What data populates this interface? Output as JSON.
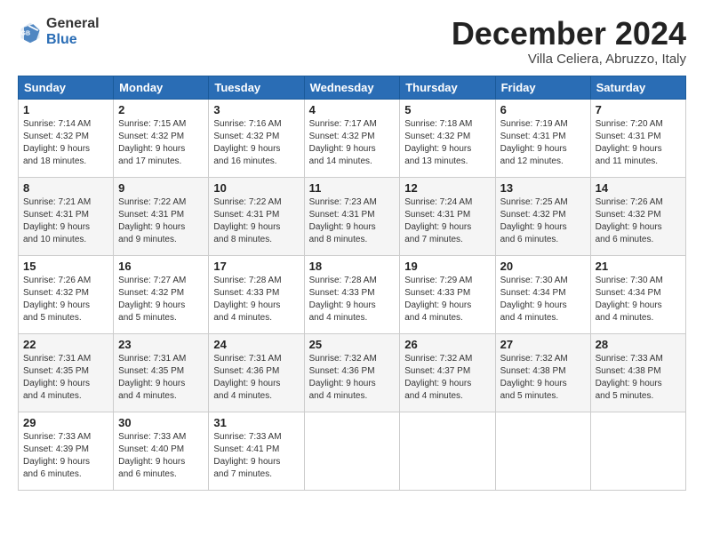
{
  "logo": {
    "general": "General",
    "blue": "Blue"
  },
  "title": "December 2024",
  "location": "Villa Celiera, Abruzzo, Italy",
  "days_of_week": [
    "Sunday",
    "Monday",
    "Tuesday",
    "Wednesday",
    "Thursday",
    "Friday",
    "Saturday"
  ],
  "weeks": [
    [
      {
        "day": "1",
        "sunrise": "7:14 AM",
        "sunset": "4:32 PM",
        "daylight_hours": "9",
        "daylight_minutes": "18"
      },
      {
        "day": "2",
        "sunrise": "7:15 AM",
        "sunset": "4:32 PM",
        "daylight_hours": "9",
        "daylight_minutes": "17"
      },
      {
        "day": "3",
        "sunrise": "7:16 AM",
        "sunset": "4:32 PM",
        "daylight_hours": "9",
        "daylight_minutes": "16"
      },
      {
        "day": "4",
        "sunrise": "7:17 AM",
        "sunset": "4:32 PM",
        "daylight_hours": "9",
        "daylight_minutes": "14"
      },
      {
        "day": "5",
        "sunrise": "7:18 AM",
        "sunset": "4:32 PM",
        "daylight_hours": "9",
        "daylight_minutes": "13"
      },
      {
        "day": "6",
        "sunrise": "7:19 AM",
        "sunset": "4:31 PM",
        "daylight_hours": "9",
        "daylight_minutes": "12"
      },
      {
        "day": "7",
        "sunrise": "7:20 AM",
        "sunset": "4:31 PM",
        "daylight_hours": "9",
        "daylight_minutes": "11"
      }
    ],
    [
      {
        "day": "8",
        "sunrise": "7:21 AM",
        "sunset": "4:31 PM",
        "daylight_hours": "9",
        "daylight_minutes": "10"
      },
      {
        "day": "9",
        "sunrise": "7:22 AM",
        "sunset": "4:31 PM",
        "daylight_hours": "9",
        "daylight_minutes": "9"
      },
      {
        "day": "10",
        "sunrise": "7:22 AM",
        "sunset": "4:31 PM",
        "daylight_hours": "9",
        "daylight_minutes": "8"
      },
      {
        "day": "11",
        "sunrise": "7:23 AM",
        "sunset": "4:31 PM",
        "daylight_hours": "9",
        "daylight_minutes": "8"
      },
      {
        "day": "12",
        "sunrise": "7:24 AM",
        "sunset": "4:31 PM",
        "daylight_hours": "9",
        "daylight_minutes": "7"
      },
      {
        "day": "13",
        "sunrise": "7:25 AM",
        "sunset": "4:32 PM",
        "daylight_hours": "9",
        "daylight_minutes": "6"
      },
      {
        "day": "14",
        "sunrise": "7:26 AM",
        "sunset": "4:32 PM",
        "daylight_hours": "9",
        "daylight_minutes": "6"
      }
    ],
    [
      {
        "day": "15",
        "sunrise": "7:26 AM",
        "sunset": "4:32 PM",
        "daylight_hours": "9",
        "daylight_minutes": "5"
      },
      {
        "day": "16",
        "sunrise": "7:27 AM",
        "sunset": "4:32 PM",
        "daylight_hours": "9",
        "daylight_minutes": "5"
      },
      {
        "day": "17",
        "sunrise": "7:28 AM",
        "sunset": "4:33 PM",
        "daylight_hours": "9",
        "daylight_minutes": "4"
      },
      {
        "day": "18",
        "sunrise": "7:28 AM",
        "sunset": "4:33 PM",
        "daylight_hours": "9",
        "daylight_minutes": "4"
      },
      {
        "day": "19",
        "sunrise": "7:29 AM",
        "sunset": "4:33 PM",
        "daylight_hours": "9",
        "daylight_minutes": "4"
      },
      {
        "day": "20",
        "sunrise": "7:30 AM",
        "sunset": "4:34 PM",
        "daylight_hours": "9",
        "daylight_minutes": "4"
      },
      {
        "day": "21",
        "sunrise": "7:30 AM",
        "sunset": "4:34 PM",
        "daylight_hours": "9",
        "daylight_minutes": "4"
      }
    ],
    [
      {
        "day": "22",
        "sunrise": "7:31 AM",
        "sunset": "4:35 PM",
        "daylight_hours": "9",
        "daylight_minutes": "4"
      },
      {
        "day": "23",
        "sunrise": "7:31 AM",
        "sunset": "4:35 PM",
        "daylight_hours": "9",
        "daylight_minutes": "4"
      },
      {
        "day": "24",
        "sunrise": "7:31 AM",
        "sunset": "4:36 PM",
        "daylight_hours": "9",
        "daylight_minutes": "4"
      },
      {
        "day": "25",
        "sunrise": "7:32 AM",
        "sunset": "4:36 PM",
        "daylight_hours": "9",
        "daylight_minutes": "4"
      },
      {
        "day": "26",
        "sunrise": "7:32 AM",
        "sunset": "4:37 PM",
        "daylight_hours": "9",
        "daylight_minutes": "4"
      },
      {
        "day": "27",
        "sunrise": "7:32 AM",
        "sunset": "4:38 PM",
        "daylight_hours": "9",
        "daylight_minutes": "5"
      },
      {
        "day": "28",
        "sunrise": "7:33 AM",
        "sunset": "4:38 PM",
        "daylight_hours": "9",
        "daylight_minutes": "5"
      }
    ],
    [
      {
        "day": "29",
        "sunrise": "7:33 AM",
        "sunset": "4:39 PM",
        "daylight_hours": "9",
        "daylight_minutes": "6"
      },
      {
        "day": "30",
        "sunrise": "7:33 AM",
        "sunset": "4:40 PM",
        "daylight_hours": "9",
        "daylight_minutes": "6"
      },
      {
        "day": "31",
        "sunrise": "7:33 AM",
        "sunset": "4:41 PM",
        "daylight_hours": "9",
        "daylight_minutes": "7"
      },
      null,
      null,
      null,
      null
    ]
  ]
}
